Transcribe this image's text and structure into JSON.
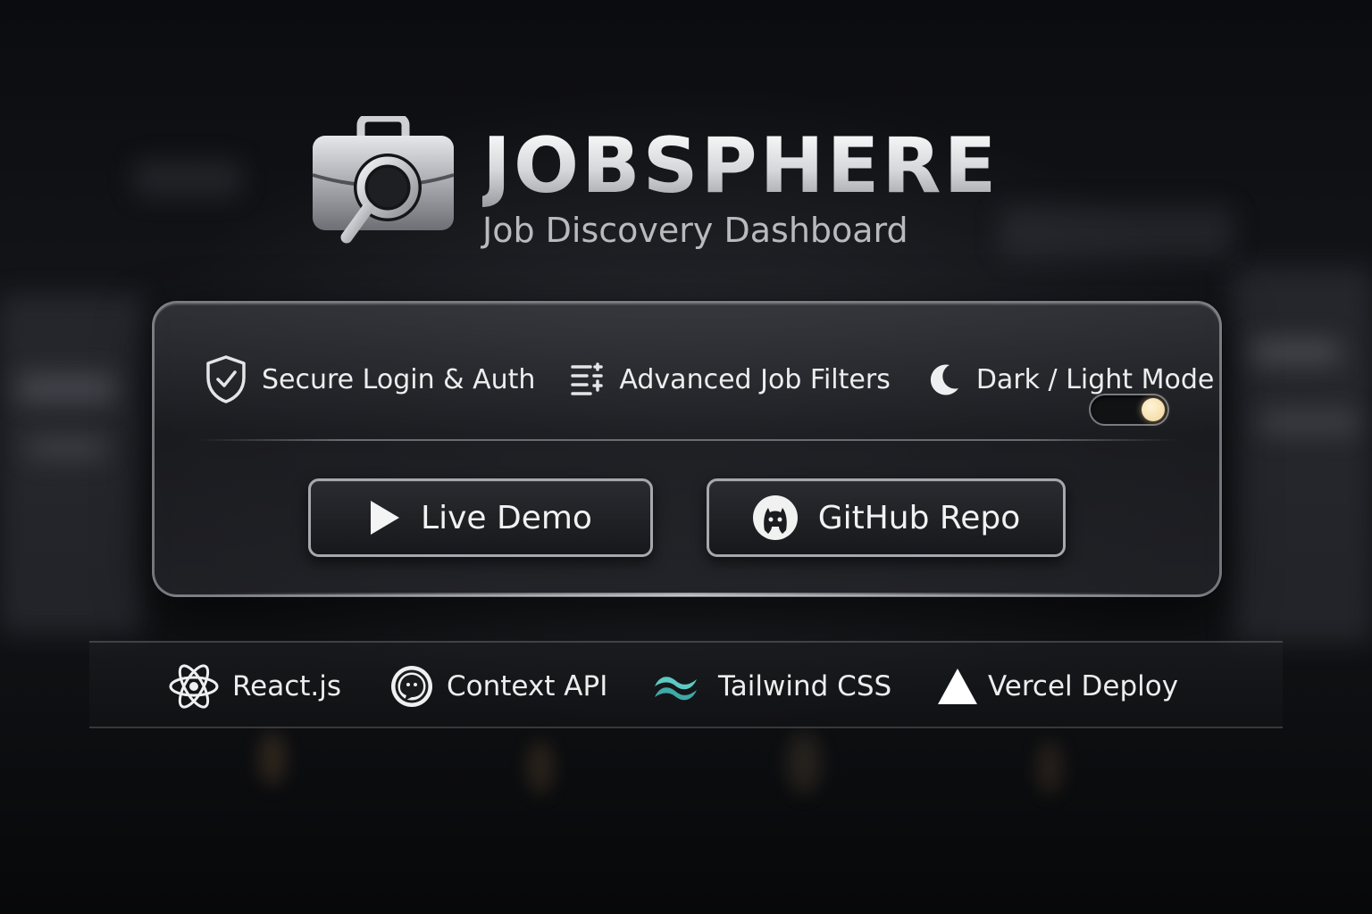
{
  "brand": {
    "title": "JOBSPHERE",
    "subtitle": "Job Discovery Dashboard",
    "logo_icon": "briefcase-search-icon"
  },
  "features": [
    {
      "label": "Secure Login & Auth",
      "icon": "shield-check-icon"
    },
    {
      "label": "Advanced Job Filters",
      "icon": "filter-list-icon"
    },
    {
      "label": "Dark / Light Mode",
      "icon": "moon-icon"
    }
  ],
  "theme_toggle": {
    "state": "on",
    "knob_color": "#f3dfa8"
  },
  "actions": {
    "demo_label": "Live Demo",
    "github_label": "GitHub Repo"
  },
  "tech_stack": [
    {
      "label": "React.js",
      "icon": "react-icon"
    },
    {
      "label": "Context API",
      "icon": "context-api-icon"
    },
    {
      "label": "Tailwind CSS",
      "icon": "tailwind-icon",
      "color": "#5ec9c3"
    },
    {
      "label": "Vercel Deploy",
      "icon": "vercel-triangle-icon"
    }
  ]
}
